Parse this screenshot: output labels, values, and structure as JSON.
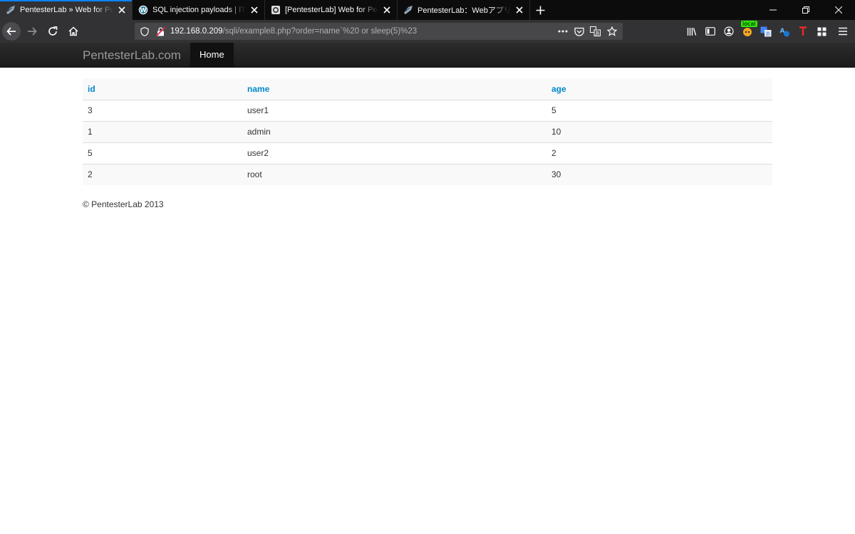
{
  "browser": {
    "tabs": [
      {
        "title": "PentesterLab » Web for Pentester",
        "favicon": "pentesterlab-favicon",
        "active": true
      },
      {
        "title": "SQL injection payloads | IT Security",
        "favicon": "wordpress-favicon",
        "active": false
      },
      {
        "title": "[PentesterLab] Web for Pentester",
        "favicon": "page-favicon",
        "active": false
      },
      {
        "title": "PentesterLab：Webアプリのペネ",
        "favicon": "pentesterlab-favicon",
        "active": false
      }
    ],
    "new_tab_label": "+",
    "address": {
      "host": "192.168.0.209",
      "path": "/sqli/example8.php?order=name`%20 or sleep(5)%23"
    },
    "extension_badge": "local",
    "colors": {
      "tab_active": "#323234",
      "accent": "#0a84ff",
      "titlebar": "#0c0c0d"
    }
  },
  "site": {
    "brand": "PentesterLab.com",
    "nav": {
      "home": "Home"
    },
    "table": {
      "headers": [
        "id",
        "name",
        "age"
      ],
      "rows": [
        [
          "3",
          "user1",
          "5"
        ],
        [
          "1",
          "admin",
          "10"
        ],
        [
          "5",
          "user2",
          "2"
        ],
        [
          "2",
          "root",
          "30"
        ]
      ]
    },
    "footer": "© PentesterLab 2013",
    "colors": {
      "header_link": "#0088cc",
      "navbar": "#1b1b1b"
    }
  }
}
